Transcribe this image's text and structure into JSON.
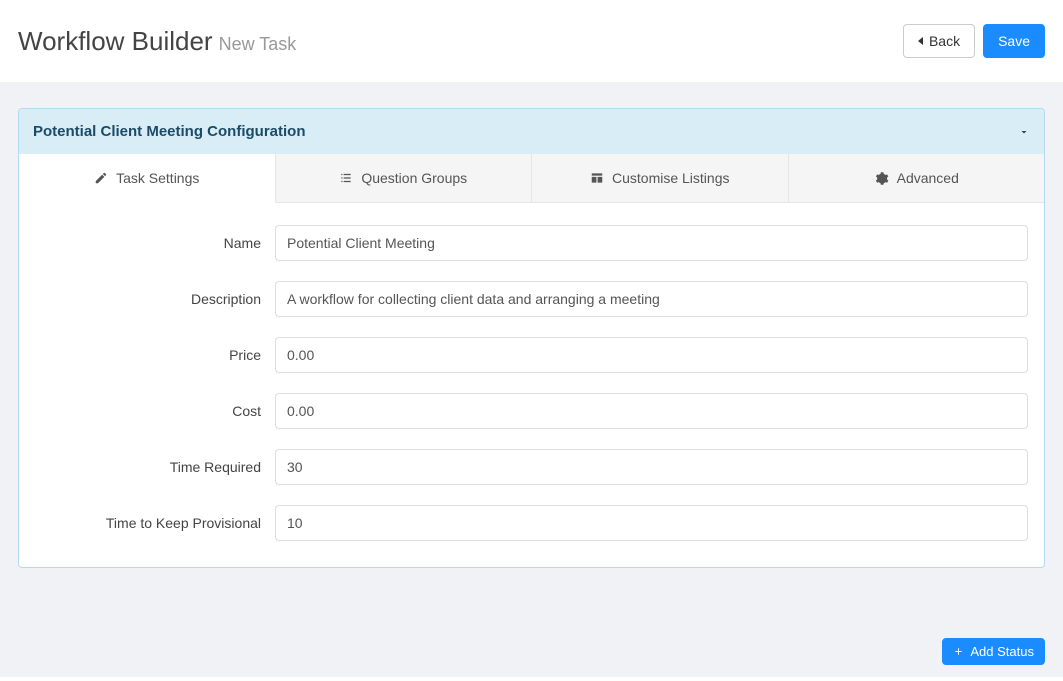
{
  "header": {
    "title": "Workflow Builder",
    "subtitle": "New Task",
    "back_label": "Back",
    "save_label": "Save"
  },
  "panel": {
    "title": "Potential Client Meeting Configuration"
  },
  "tabs": [
    {
      "label": "Task Settings"
    },
    {
      "label": "Question Groups"
    },
    {
      "label": "Customise Listings"
    },
    {
      "label": "Advanced"
    }
  ],
  "form": {
    "name_label": "Name",
    "name_value": "Potential Client Meeting",
    "description_label": "Description",
    "description_value": "A workflow for collecting client data and arranging a meeting",
    "price_label": "Price",
    "price_value": "0.00",
    "cost_label": "Cost",
    "cost_value": "0.00",
    "time_required_label": "Time Required",
    "time_required_value": "30",
    "time_provisional_label": "Time to Keep Provisional",
    "time_provisional_value": "10"
  },
  "footer": {
    "add_status_label": "Add Status"
  }
}
